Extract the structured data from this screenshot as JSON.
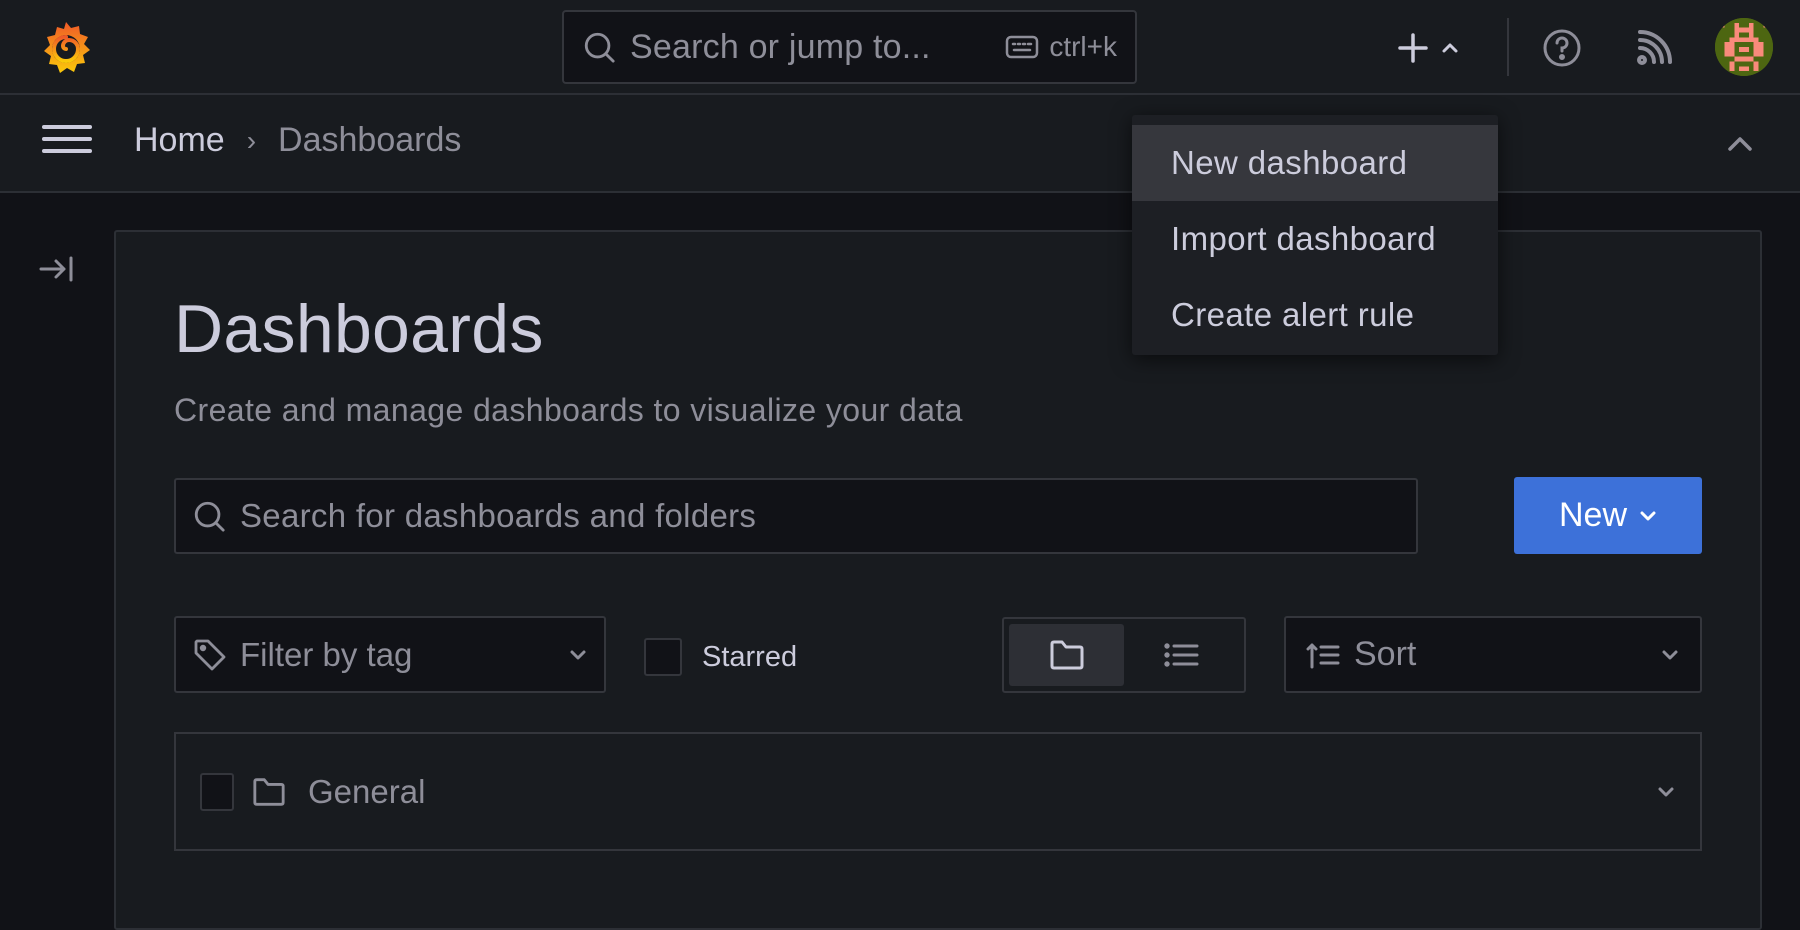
{
  "topbar": {
    "search_placeholder": "Search or jump to...",
    "search_shortcut": "ctrl+k",
    "add_icon": "plus-icon",
    "help_icon": "help-circle-icon",
    "news_icon": "rss-icon"
  },
  "breadcrumb": {
    "items": [
      {
        "label": "Home"
      },
      {
        "label": "Dashboards"
      }
    ],
    "separator": "›"
  },
  "page": {
    "title": "Dashboards",
    "subtitle": "Create and manage dashboards to visualize your data"
  },
  "search": {
    "placeholder": "Search for dashboards and folders"
  },
  "new_button": {
    "label": "New"
  },
  "filters": {
    "tag_placeholder": "Filter by tag",
    "starred_label": "Starred",
    "starred_checked": false,
    "view_mode": "folders",
    "sort_placeholder": "Sort"
  },
  "folders": [
    {
      "name": "General",
      "checked": false
    }
  ],
  "new_menu": {
    "items": [
      {
        "label": "New dashboard",
        "highlighted": true
      },
      {
        "label": "Import dashboard",
        "highlighted": false
      },
      {
        "label": "Create alert rule",
        "highlighted": false
      }
    ]
  },
  "colors": {
    "primary": "#3d71d9",
    "bg": "#111217",
    "surface": "#181b1f",
    "border": "#34363c",
    "text": "#ccccdc",
    "text_secondary": "#8e8e99",
    "avatar_bg": "#4d6611",
    "avatar_fg": "#f98a7b"
  }
}
